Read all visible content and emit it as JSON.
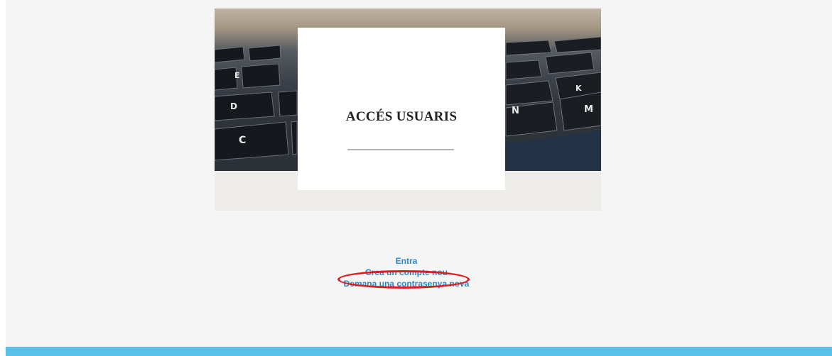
{
  "hero": {
    "title": "ACCÉS USUARIS",
    "photo_keys": [
      "E",
      "D",
      "C",
      "N",
      "M",
      "K"
    ]
  },
  "links": {
    "login": "Entra",
    "create_account": "Crea un compte nou",
    "new_password": "Demana una contrasenya nova"
  },
  "colors": {
    "page_background": "#f5f5f5",
    "link": "#2b86c8",
    "bottom_bar": "#5bc0e8",
    "annotation": "#e01b1b"
  }
}
